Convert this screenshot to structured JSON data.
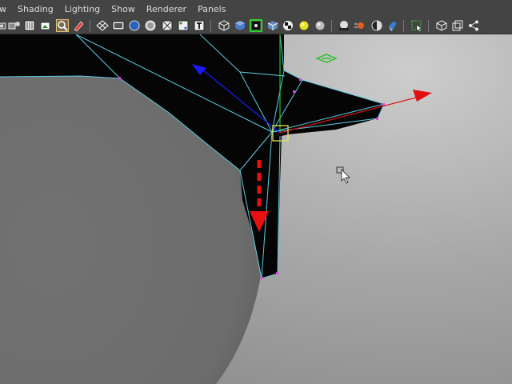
{
  "menubar": {
    "items": [
      {
        "label": "w"
      },
      {
        "label": "Shading"
      },
      {
        "label": "Lighting"
      },
      {
        "label": "Show"
      },
      {
        "label": "Renderer"
      },
      {
        "label": "Panels"
      }
    ]
  },
  "toolbar": {
    "buttons": [
      {
        "icon": "select-camera-icon"
      },
      {
        "icon": "camera-attributes-icon"
      },
      {
        "icon": "bookmark-icon"
      },
      {
        "icon": "image-plane-icon"
      },
      {
        "icon": "two-d-pan-zoom-icon"
      },
      {
        "icon": "grease-pencil-icon"
      },
      {
        "icon": "grid-icon"
      },
      {
        "icon": "film-gate-icon"
      },
      {
        "icon": "resolution-gate-icon"
      },
      {
        "icon": "gate-mask-icon"
      },
      {
        "icon": "field-chart-icon"
      },
      {
        "icon": "safe-action-icon"
      },
      {
        "icon": "safe-title-icon"
      },
      {
        "icon": "wireframe-icon"
      },
      {
        "icon": "smooth-shade-icon"
      },
      {
        "icon": "wireframe-on-shaded-icon"
      },
      {
        "icon": "xray-icon"
      },
      {
        "icon": "textured-icon"
      },
      {
        "icon": "use-all-lights-icon"
      },
      {
        "icon": "shadows-icon"
      },
      {
        "icon": "screen-space-ao-icon"
      },
      {
        "icon": "motion-blur-icon"
      },
      {
        "icon": "multisample-aa-icon"
      },
      {
        "icon": "depth-of-field-icon"
      },
      {
        "icon": "isolate-select-icon"
      },
      {
        "icon": "xray-joints-icon"
      },
      {
        "icon": "xray-active-components-icon"
      },
      {
        "icon": "snap-to-pixel-icon"
      }
    ]
  },
  "viewport": {
    "colors": {
      "background": "#a6a6a6",
      "surface": "#6e6e6e",
      "mesh": "#050505",
      "wire": "#5ecbe0",
      "vertex": "#e040e0",
      "manip_x": "#e01010",
      "manip_y": "#20c020",
      "manip_z": "#1a1aff",
      "center": "#e8e060"
    }
  }
}
